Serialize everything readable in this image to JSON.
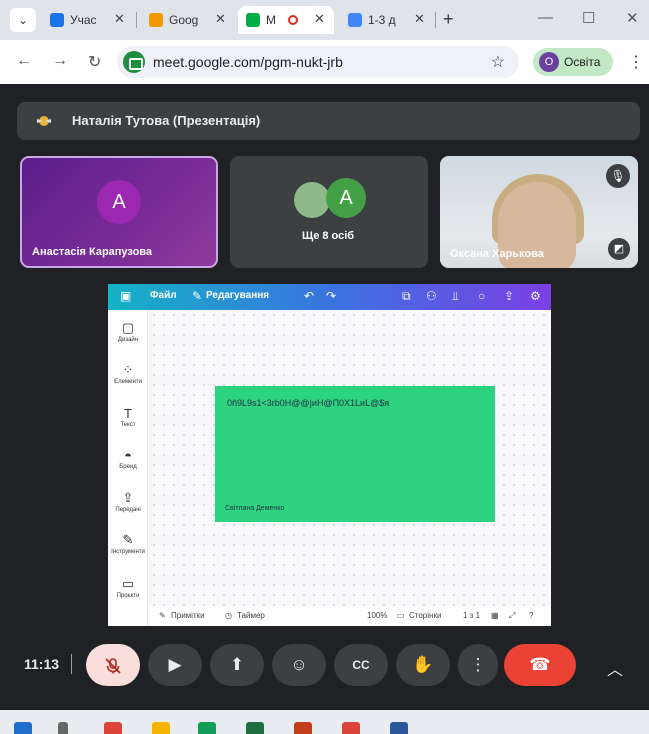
{
  "browser": {
    "tabs": [
      {
        "label": "Учас",
        "color": "#1a73e8",
        "active": false
      },
      {
        "label": "Goog",
        "color": "#f29900",
        "active": false
      },
      {
        "label": "М",
        "color": "#00ac47",
        "active": true
      },
      {
        "label": "1-3 д",
        "color": "#4285f4",
        "active": false
      }
    ],
    "url": "meet.google.com/pgm-nukt-jrb",
    "profile_initial": "O",
    "profile_label": "Освіта"
  },
  "meet": {
    "presenter_label": "Наталія Тутова (Презентація)",
    "participants": [
      {
        "name": "Анастасія Карапузова",
        "initial": "A",
        "avatar_color": "#9c27b0"
      },
      {
        "name": "Ще 8 осіб",
        "initial": "A",
        "avatar_color": "#43a047"
      },
      {
        "name": "Оксана Харькова"
      }
    ],
    "time": "11:13"
  },
  "canva": {
    "menu_file": "Файл",
    "menu_edit": "Редагування",
    "side": [
      {
        "label": "Дизайн",
        "icon": "▢"
      },
      {
        "label": "Елементи",
        "icon": "⁘"
      },
      {
        "label": "Текст",
        "icon": "T"
      },
      {
        "label": "Бренд",
        "icon": "◓"
      },
      {
        "label": "Передачі",
        "icon": "⇪"
      },
      {
        "label": "Інструменти",
        "icon": "✎"
      },
      {
        "label": "Проєкти",
        "icon": "▭"
      }
    ],
    "slide_code": "0ñ9L9s1<3rb0H@@|иH@П0X1LиL@$я",
    "slide_author": "Світлана Деменко",
    "slide_color": "#2ed37f",
    "footer": {
      "notes": "Примітки",
      "timer": "Таймер",
      "zoom": "100%",
      "pages": "Сторінки",
      "page_count": "1 з 1"
    }
  }
}
